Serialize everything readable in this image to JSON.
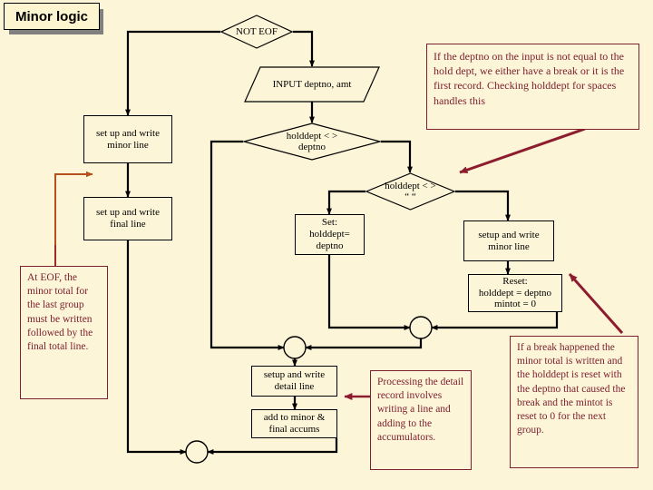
{
  "slide": {
    "title": "Minor logic",
    "background_color": "#fdf5d8",
    "note_color": "#7d2030",
    "flow_color": "#000000",
    "accent_arrow_color": "#b5501e"
  },
  "nodes": {
    "not_eof": "NOT EOF",
    "input_deptno_amt": "INPUT deptno, amt",
    "setup_write_minor_line_left": "set up and write\nminor line",
    "setup_write_final_line": "set up and write\nfinal line",
    "holddept_ne_deptno": "holddept < >\ndeptno",
    "holddept_ne_spaces": "holddept < >\n“ “",
    "set_holddept_deptno": "Set:\nholddept=\ndeptno",
    "setup_write_minor_line_right": "setup and write\nminor line",
    "reset_holddept_mintot": "Reset:\nholddept = deptno\nmintot = 0",
    "setup_write_detail_line": "setup and write\ndetail line",
    "add_to_accums": "add to minor &\nfinal accums"
  },
  "notes": {
    "deptno_check": "If the deptno on the input is not equal to the hold dept, we either have a break or it is the first record.  Checking holddept for spaces handles this",
    "at_eof": "At EOF, the minor total for the last group must be written followed by the final total line.",
    "processing_detail": "Processing the detail record involves writing a line and adding to the accumulators.",
    "break_happened": "If a break happened the minor total is written and the holddept is reset with the deptno that caused the break and the mintot is reset to 0 for the next group."
  }
}
